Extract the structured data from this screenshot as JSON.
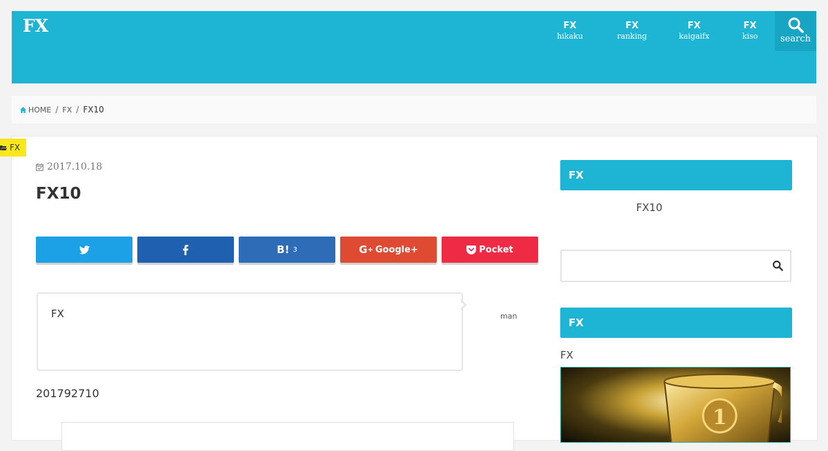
{
  "header": {
    "logo_lines": [
      "",
      "FX",
      ""
    ],
    "nav": [
      {
        "big": "FX",
        "small": "hikaku"
      },
      {
        "big": "FX",
        "small": "ranking"
      },
      {
        "big": "FX",
        "small": "kaigaifx"
      },
      {
        "big": "FX",
        "small": "kiso"
      }
    ],
    "search_label": "search",
    "colors": {
      "header": "#1eb4d4",
      "search_bg": "#18a5c4"
    }
  },
  "breadcrumb": {
    "home": "HOME",
    "category": "FX",
    "current": "FX10"
  },
  "article": {
    "category_badge": "FX",
    "date": "2017.10.18",
    "title": "FX10",
    "share": [
      {
        "label": "",
        "icon": "twitter-icon",
        "color": "#1da1e6"
      },
      {
        "label": "",
        "icon": "facebook-icon",
        "color": "#2060b0"
      },
      {
        "label": "B!",
        "count": "3",
        "icon": "hatena-icon",
        "color": "#2e6cb8"
      },
      {
        "label": "Google+",
        "icon": "google-plus-icon",
        "color": "#df4a32"
      },
      {
        "label": "Pocket",
        "icon": "pocket-icon",
        "color": "#ee2a45"
      }
    ],
    "bubble_text": "FX",
    "speaker": "man",
    "paragraph": "201792710"
  },
  "sidebar": {
    "section1_title": "FX",
    "section1_text": "FX10",
    "search_placeholder": "",
    "section2_title": "FX",
    "section2_text": "FX"
  }
}
